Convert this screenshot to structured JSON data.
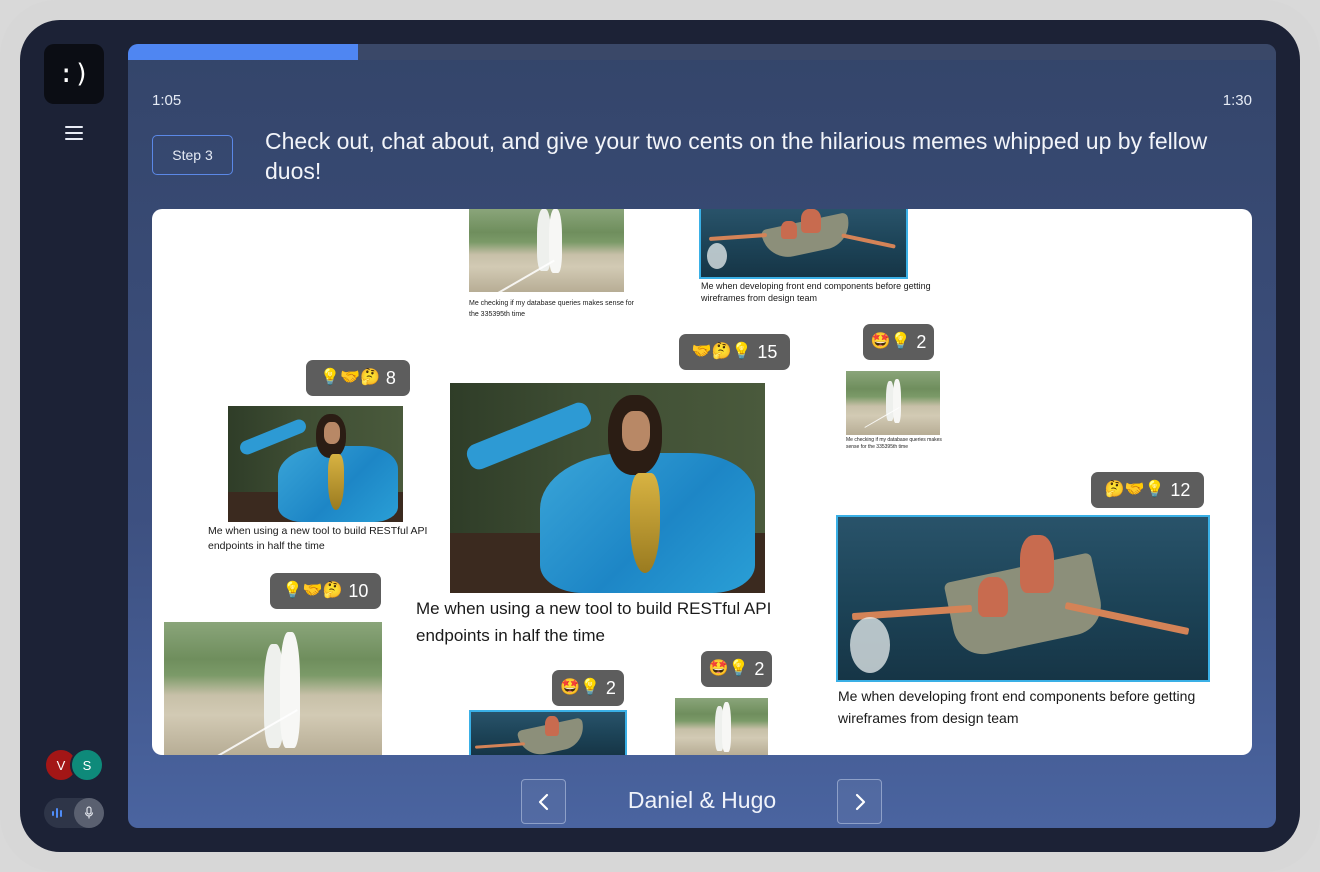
{
  "app": {
    "logo_text": ":)",
    "menu_icon": "hamburger-menu-icon"
  },
  "timer": {
    "elapsed": "1:05",
    "total": "1:30",
    "progress": 0.2
  },
  "step": {
    "label": "Step 3",
    "instructions": "Check out, chat about, and give your two cents on the hilarious memes whipped up by fellow duos!"
  },
  "participants": [
    {
      "initial": "V",
      "color": "#a31616"
    },
    {
      "initial": "S",
      "color": "#0e8a7a"
    }
  ],
  "memes": {
    "top_cricket": {
      "caption": "Me checking if my database queries makes sense for the 335395th time"
    },
    "top_boat": {
      "caption": "Me when developing front end components before getting wireframes from design team"
    },
    "left_robe": {
      "caption": "Me when using a new tool to build RESTful API endpoints in half the time",
      "reactions": "💡🤝🤔",
      "count": "8"
    },
    "center_robe": {
      "caption": "Me when using a new tool to build RESTful API endpoints in half the time",
      "reactions": "🤝🤔💡",
      "count": "15"
    },
    "small_cricket": {
      "caption": "Me checking if my database queries makes sense for the 335395th time",
      "reactions": "🤩💡",
      "count": "2"
    },
    "big_boat": {
      "caption": "Me when developing front end components before getting wireframes from design team",
      "reactions": "🤔🤝💡",
      "count": "12"
    },
    "left_cricket": {
      "reactions": "💡🤝🤔",
      "count": "10"
    },
    "bottom_boat": {
      "reactions": "🤩💡",
      "count": "2"
    },
    "bottom_cricket": {
      "reactions": "🤩💡",
      "count": "2"
    }
  },
  "navigation": {
    "team": "Daniel & Hugo",
    "prev_icon": "chevron-left-icon",
    "next_icon": "chevron-right-icon"
  }
}
